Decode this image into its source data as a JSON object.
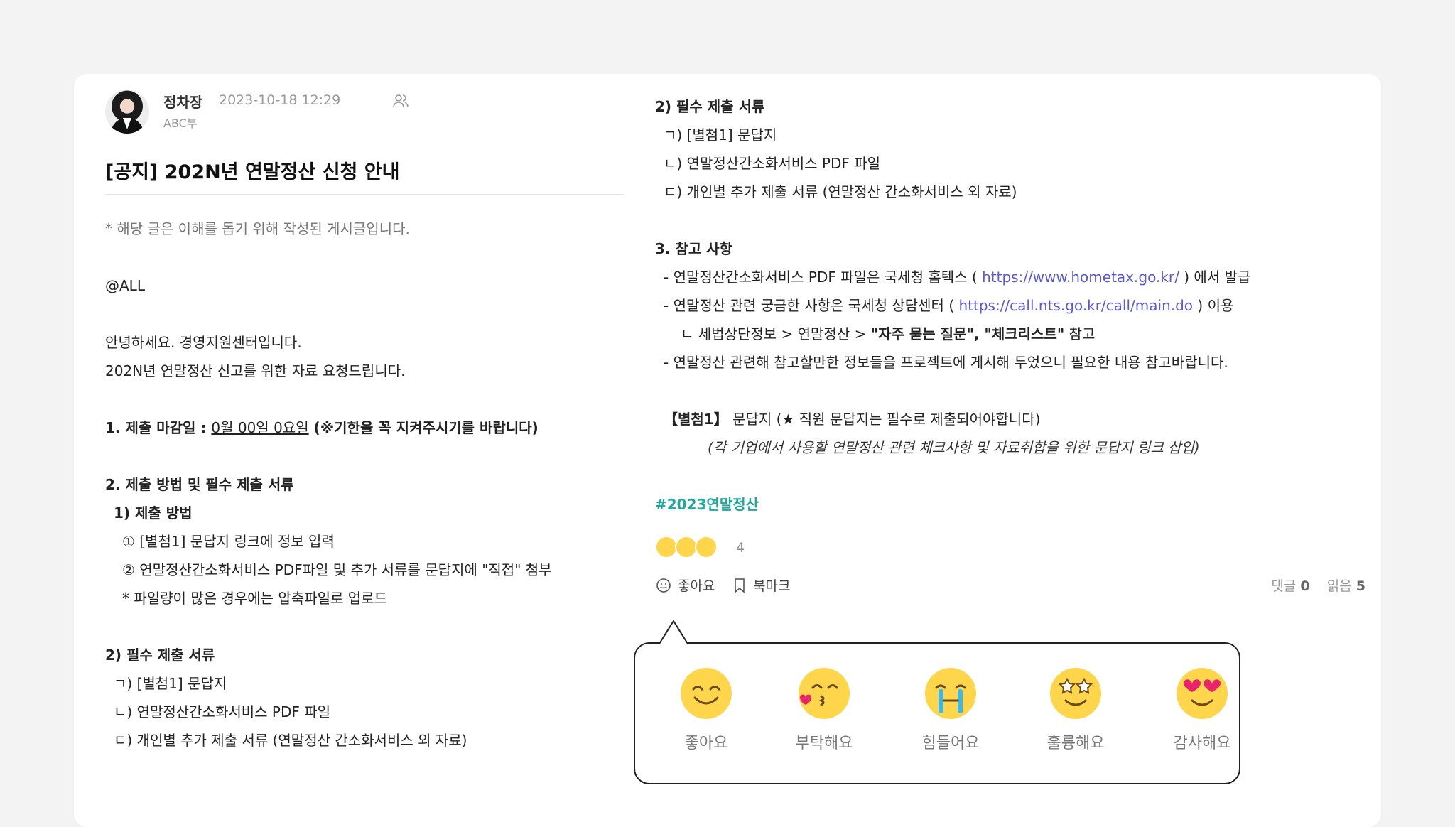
{
  "post": {
    "author": "정차장",
    "date": "2023-10-18 12:29",
    "department": "ABC부",
    "title": "[공지] 202N년 연말정산 신청 안내"
  },
  "left_body": {
    "note": "* 해당 글은 이해를 돕기 위해 작성된 게시글입니다.",
    "mention": "@ALL",
    "greeting1": "안녕하세요. 경영지원센터입니다.",
    "greeting2": "202N년 연말정산 신고를 위한 자료 요청드립니다.",
    "deadline_label": "1. 제출 마감일 : ",
    "deadline_date": "0월 00일 0요일",
    "deadline_note": " (※기한을 꼭 지켜주시기를 바랍니다)",
    "section2": "2. 제출 방법 및 필수 제출 서류",
    "method_title": "1) 제출 방법",
    "method1": "① [별첨1] 문답지 링크에 정보 입력",
    "method2": "② 연말정산간소화서비스 PDF파일 및 추가 서류를 문답지에 \"직접\" 첨부",
    "method3": "* 파일량이 많은 경우에는 압축파일로 업로드",
    "docs_title": "2) 필수 제출 서류",
    "doc1": "ㄱ) [별첨1] 문답지",
    "doc2": "ㄴ) 연말정산간소화서비스 PDF 파일",
    "doc3": "ㄷ) 개인별 추가 제출 서류 (연말정산 간소화서비스 외 자료)"
  },
  "right_body": {
    "docs_title": "2) 필수 제출 서류",
    "doc1": "ㄱ) [별첨1] 문답지",
    "doc2": "ㄴ) 연말정산간소화서비스 PDF 파일",
    "doc3": "ㄷ) 개인별 추가 제출 서류 (연말정산 간소화서비스 외 자료)",
    "section3": "3. 참고 사항",
    "ref1_pre": "- 연말정산간소화서비스 PDF 파일은 국세청 홈텍스 ( ",
    "ref1_link": "https://www.hometax.go.kr/",
    "ref1_post": " ) 에서 발급",
    "ref2_pre": "- 연말정산 관련 궁금한 사항은 국세청 상담센터 ( ",
    "ref2_link": "https://call.nts.go.kr/call/main.do",
    "ref2_post": "  ) 이용",
    "ref3_pre": "ㄴ 세법상단정보 > 연말정산 > ",
    "ref3_bold": "\"자주 묻는 질문\", \"체크리스트\"",
    "ref3_post": " 참고",
    "ref4": "- 연말정산 관련해 참고할만한 정보들을 프로젝트에 게시해 두었으니 필요한 내용 참고바랍니다.",
    "attach_label": "【별첨1】",
    "attach_text": "  문답지 (★ 직원 문답지는 필수로 제출되어야합니다)",
    "attach_note": "(각 기업에서 사용할 연말정산 관련 체크사항 및 자료취합을 위한 문답지 링크 삽입)",
    "hashtag": "#2023연말정산"
  },
  "reactions_summary": {
    "count": "4"
  },
  "actions": {
    "like": "좋아요",
    "bookmark": "북마크",
    "comments_label": "댓글",
    "comments_count": "0",
    "reads_label": "읽음",
    "reads_count": "5"
  },
  "reaction_popup": {
    "items": [
      {
        "label": "좋아요",
        "icon": "smile-emoji-icon"
      },
      {
        "label": "부탁해요",
        "icon": "kiss-emoji-icon"
      },
      {
        "label": "힘들어요",
        "icon": "crying-emoji-icon"
      },
      {
        "label": "훌륭해요",
        "icon": "star-eyes-emoji-icon"
      },
      {
        "label": "감사해요",
        "icon": "heart-eyes-emoji-icon"
      }
    ]
  },
  "colors": {
    "link": "#5b58d6",
    "hashtag": "#20a99c",
    "emoji_yellow": "#ffd54b"
  }
}
